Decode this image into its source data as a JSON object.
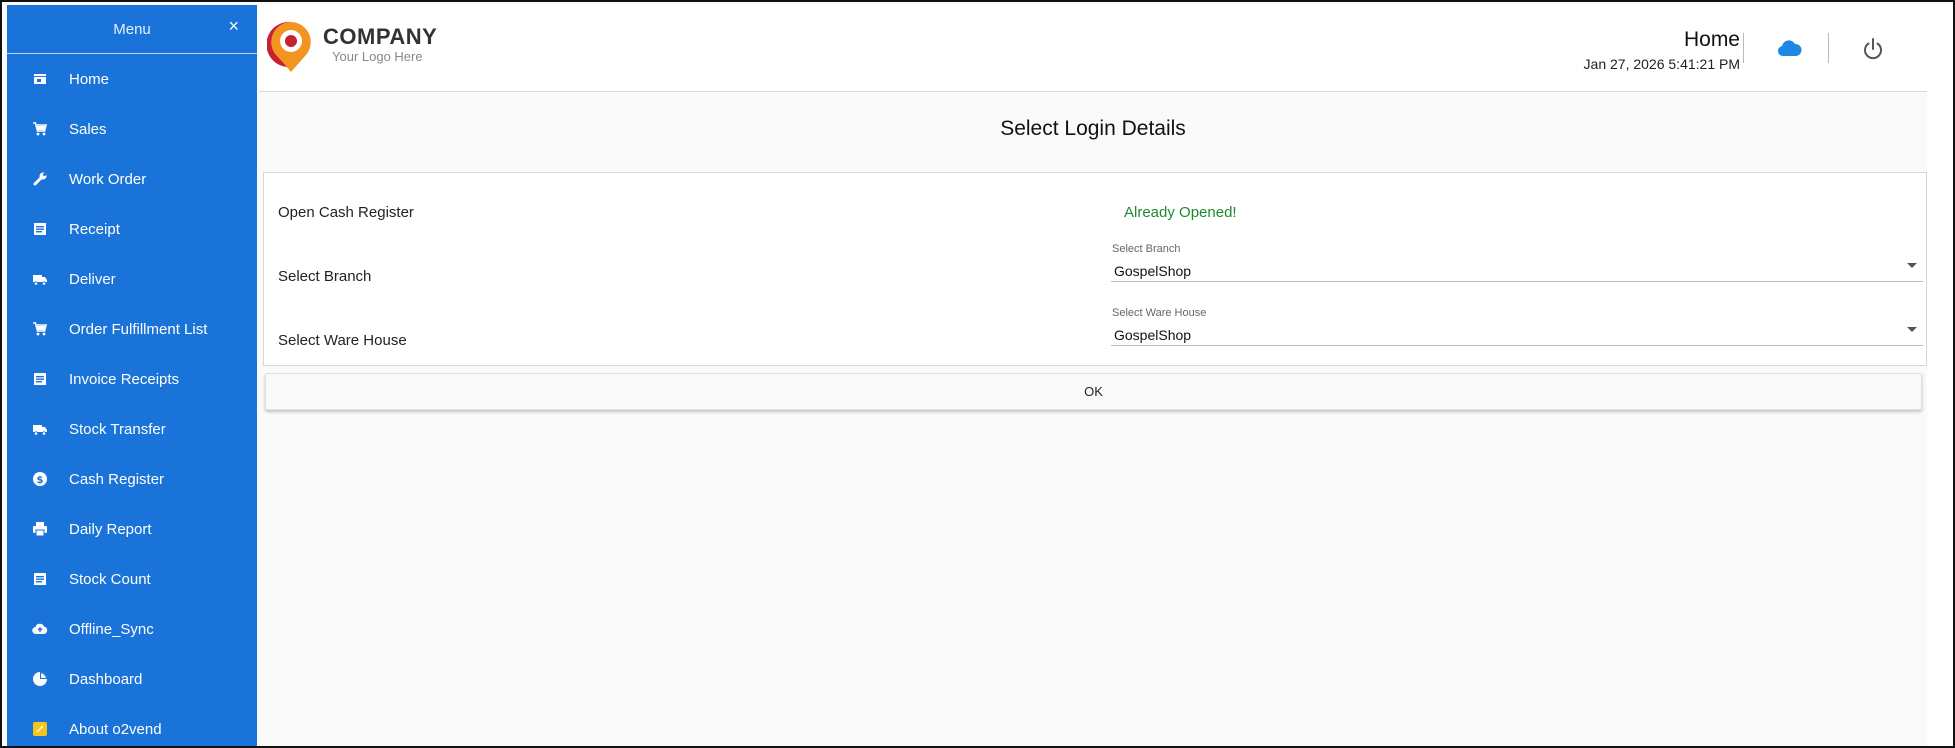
{
  "sidebar": {
    "title": "Menu",
    "close_icon": "×",
    "items": [
      {
        "label": "Home",
        "icon": "store-icon"
      },
      {
        "label": "Sales",
        "icon": "cart-icon"
      },
      {
        "label": "Work Order",
        "icon": "wrench-icon"
      },
      {
        "label": "Receipt",
        "icon": "receipt-icon"
      },
      {
        "label": "Deliver",
        "icon": "truck-icon"
      },
      {
        "label": "Order Fulfillment List",
        "icon": "cart-icon"
      },
      {
        "label": "Invoice Receipts",
        "icon": "receipt-icon"
      },
      {
        "label": "Stock Transfer",
        "icon": "truck-icon"
      },
      {
        "label": "Cash Register",
        "icon": "dollar-icon"
      },
      {
        "label": "Daily Report",
        "icon": "printer-icon"
      },
      {
        "label": "Stock Count",
        "icon": "list-icon"
      },
      {
        "label": "Offline_Sync",
        "icon": "cloud-upload-icon"
      },
      {
        "label": "Dashboard",
        "icon": "pie-chart-icon"
      },
      {
        "label": "About o2vend",
        "icon": "info-note-icon"
      }
    ]
  },
  "header": {
    "logo_name": "COMPANY",
    "logo_tagline": "Your Logo Here",
    "page_title": "Home",
    "datetime": "Jan 27, 2026 5:41:21 PM"
  },
  "main": {
    "title": "Select Login Details",
    "open_cash_register_label": "Open Cash Register",
    "cash_register_status": "Already Opened!",
    "branch": {
      "row_label": "Select Branch",
      "field_label": "Select Branch",
      "value": "GospelShop"
    },
    "warehouse": {
      "row_label": "Select Ware House",
      "field_label": "Select Ware House",
      "value": "GospelShop"
    },
    "ok_label": "OK"
  },
  "colors": {
    "sidebar_bg": "#1a73d8",
    "status_green": "#1e8a2e",
    "cloud_blue": "#1e88e5",
    "logo_red": "#c8202f",
    "logo_orange": "#f39420"
  }
}
